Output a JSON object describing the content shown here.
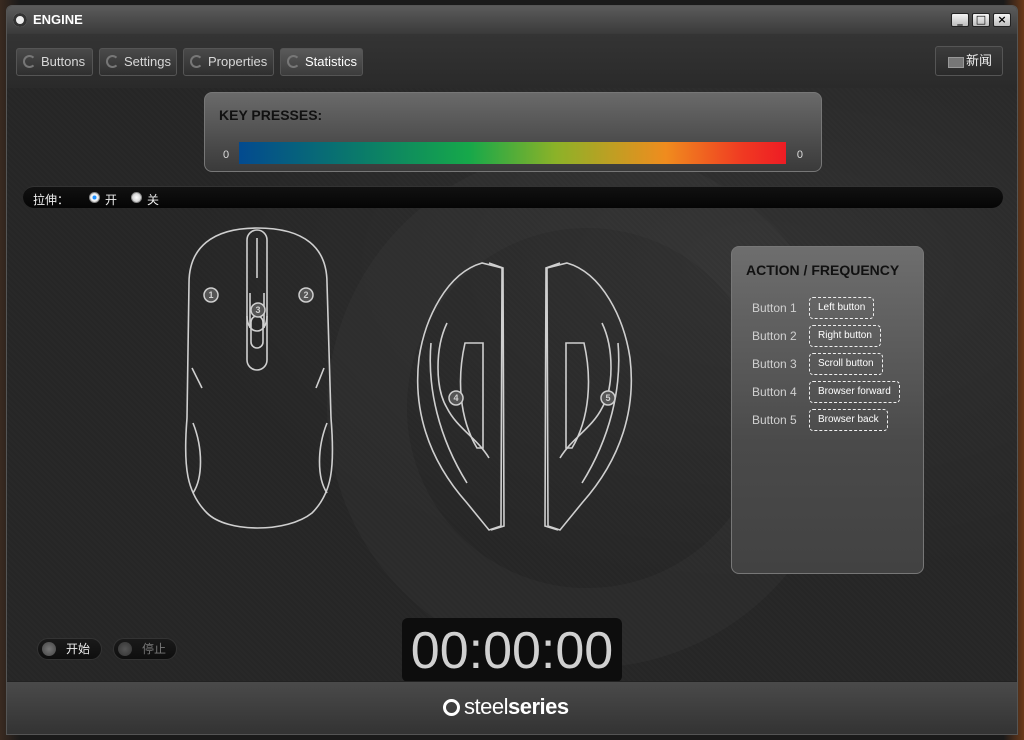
{
  "window": {
    "title": "ENGINE",
    "controls": [
      "_",
      "□",
      "×"
    ]
  },
  "toolbar": {
    "tabs": [
      {
        "label": "Buttons"
      },
      {
        "label": "Settings"
      },
      {
        "label": "Properties"
      },
      {
        "label": "Statistics",
        "active": true
      }
    ],
    "news_label": "新闻"
  },
  "key_presses": {
    "title": "KEY PRESSES:",
    "min": "0",
    "max": "0"
  },
  "stretch": {
    "label": "拉伸：",
    "options": [
      {
        "label": "开",
        "selected": true
      },
      {
        "label": "关",
        "selected": false
      }
    ]
  },
  "mouse": {
    "markers": [
      "1",
      "2",
      "3",
      "4",
      "5"
    ]
  },
  "action_frequency": {
    "title": "ACTION / FREQUENCY",
    "rows": [
      {
        "label": "Button 1",
        "action": "Left button"
      },
      {
        "label": "Button 2",
        "action": "Right button"
      },
      {
        "label": "Button 3",
        "action": "Scroll button"
      },
      {
        "label": "Button 4",
        "action": "Browser forward"
      },
      {
        "label": "Button 5",
        "action": "Browser back"
      }
    ]
  },
  "controls": {
    "start_label": "开始",
    "stop_label": "停止"
  },
  "timer": {
    "value": "00:00:00"
  },
  "footer": {
    "brand_light": "steel",
    "brand_bold": "series"
  }
}
